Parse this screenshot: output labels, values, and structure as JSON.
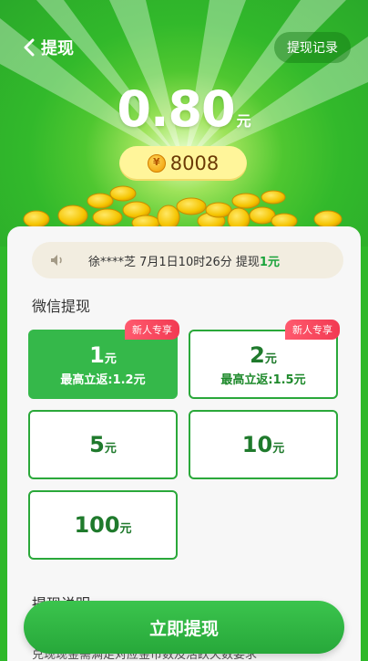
{
  "header": {
    "title": "提现",
    "records_label": "提现记录",
    "back_icon": "chevron-left-icon"
  },
  "balance": {
    "amount": "0.80",
    "unit": "元",
    "coins": "8008"
  },
  "notice": {
    "prefix": "徐****芝 7月1日10时26分 提现",
    "amount": "1元"
  },
  "withdraw": {
    "section_title": "微信提现",
    "options": [
      {
        "num": "1",
        "unit": "元",
        "rebate": "最高立返:1.2元",
        "tag": "新人专享",
        "selected": true
      },
      {
        "num": "2",
        "unit": "元",
        "rebate": "最高立返:1.5元",
        "tag": "新人专享",
        "selected": false
      },
      {
        "num": "5",
        "unit": "元",
        "rebate": "",
        "tag": "",
        "selected": false
      },
      {
        "num": "10",
        "unit": "元",
        "rebate": "",
        "tag": "",
        "selected": false
      },
      {
        "num": "100",
        "unit": "元",
        "rebate": "",
        "tag": "",
        "selected": false
      }
    ]
  },
  "explain": {
    "title": "提现说明",
    "line1": "兑现现金需满足对应金币数及活跃天数要求"
  },
  "submit_label": "立即提现",
  "colors": {
    "primary_green": "#2fb82a",
    "selected_option": "#35b84a",
    "tag_red": "#f23a52",
    "coin_pill": "#fff59a"
  }
}
